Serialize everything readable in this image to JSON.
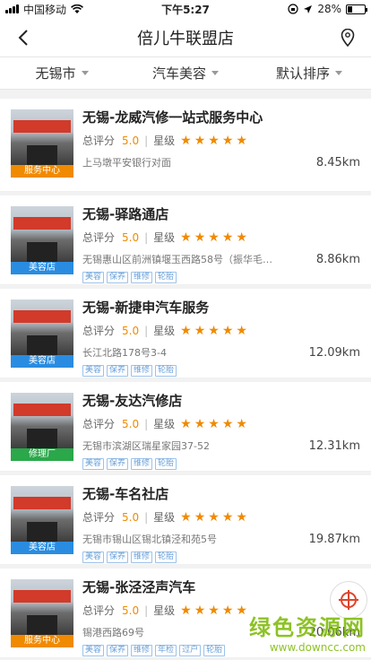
{
  "status": {
    "carrier": "中国移动",
    "time": "下午5:27",
    "battery": "28%"
  },
  "nav": {
    "title": "倍儿牛联盟店"
  },
  "filters": [
    {
      "label": "无锡市"
    },
    {
      "label": "汽车美容"
    },
    {
      "label": "默认排序"
    }
  ],
  "labels": {
    "rating_label": "总评分",
    "stars_label": "星级"
  },
  "stores": [
    {
      "name": "无锡-龙威汽修一站式服务中心",
      "score": "5.0",
      "stars": 5,
      "address": "上马墩平安银行对面",
      "distance": "8.45km",
      "type": "服务中心",
      "type_color": "#f08a00",
      "tags": []
    },
    {
      "name": "无锡-驿路通店",
      "score": "5.0",
      "stars": 5,
      "address": "无锡惠山区前洲镇堰玉西路58号（振华毛纱厂门...",
      "distance": "8.86km",
      "type": "美容店",
      "type_color": "#2a8ce0",
      "tags": [
        "美容",
        "保养",
        "维修",
        "轮胎"
      ]
    },
    {
      "name": "无锡-新捷申汽车服务",
      "score": "5.0",
      "stars": 5,
      "address": "长江北路178号3-4",
      "distance": "12.09km",
      "type": "美容店",
      "type_color": "#2a8ce0",
      "tags": [
        "美容",
        "保养",
        "维修",
        "轮胎"
      ]
    },
    {
      "name": "无锡-友达汽修店",
      "score": "5.0",
      "stars": 5,
      "address": "无锡市滨湖区瑞星家园37-52",
      "distance": "12.31km",
      "type": "修理厂",
      "type_color": "#2aa84a",
      "tags": [
        "美容",
        "保养",
        "维修",
        "轮胎"
      ]
    },
    {
      "name": "无锡-车名社店",
      "score": "5.0",
      "stars": 5,
      "address": "无锡市锡山区锡北镇泾和苑5号",
      "distance": "19.87km",
      "type": "美容店",
      "type_color": "#2a8ce0",
      "tags": [
        "美容",
        "保养",
        "维修",
        "轮胎"
      ]
    },
    {
      "name": "无锡-张泾泾声汽车",
      "score": "5.0",
      "stars": 5,
      "address": "锡港西路69号",
      "distance": "20.06km",
      "type": "服务中心",
      "type_color": "#f08a00",
      "tags": [
        "美容",
        "保养",
        "维修",
        "年检",
        "过户",
        "轮胎"
      ]
    }
  ],
  "watermark": {
    "main": "绿色资源网",
    "sub": "www.downcc.com"
  }
}
